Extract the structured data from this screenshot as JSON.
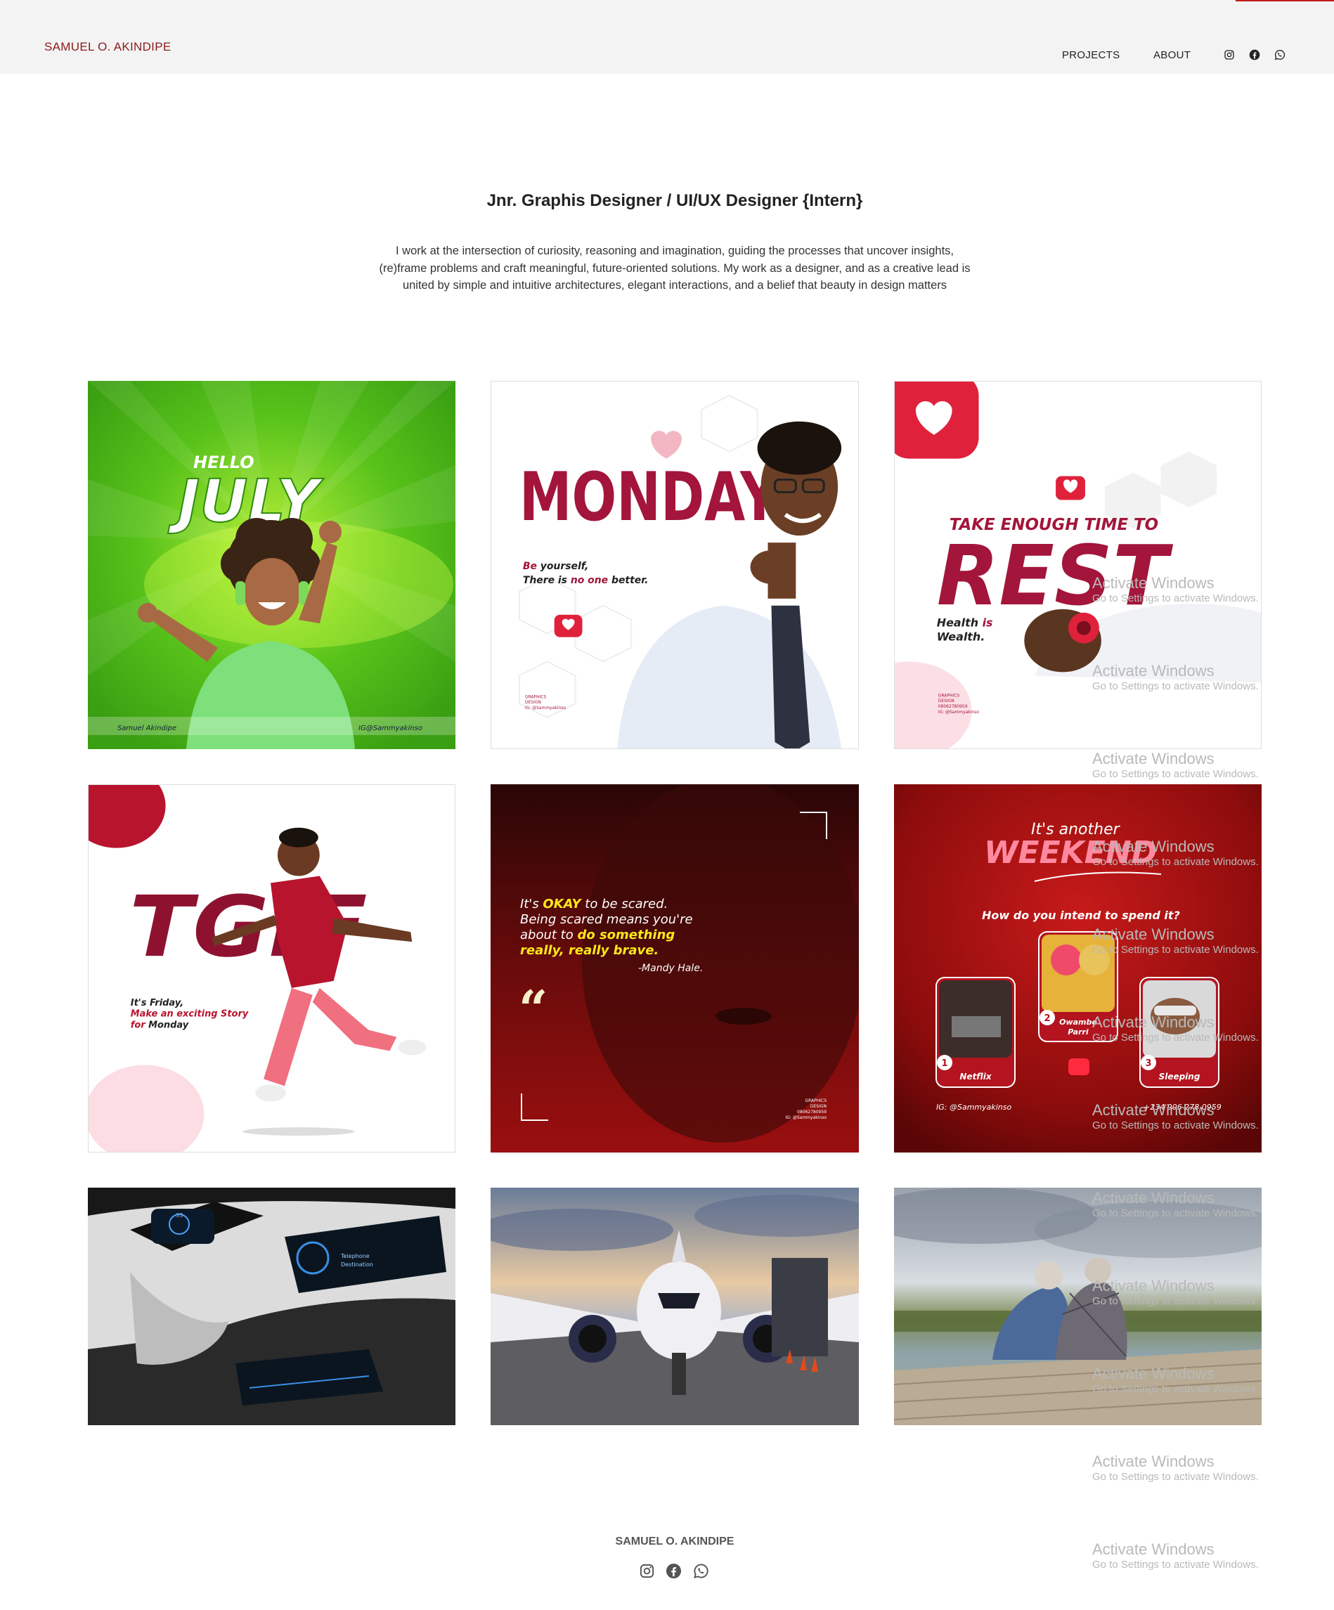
{
  "header": {
    "brand": "SAMUEL O. AKINDIPE",
    "nav": {
      "projects": "PROJECTS",
      "about": "ABOUT"
    },
    "social_icons": [
      "instagram-icon",
      "facebook-icon",
      "whatsapp-icon"
    ],
    "accent_color": "#8b1a1a"
  },
  "hero": {
    "title": "Jnr. Graphis Designer / UI/UX Designer {Intern}",
    "description_lines": [
      "I work at the intersection of curiosity, reasoning and imagination, guiding the processes that uncover insights,",
      "(re)frame problems and craft meaningful, future-oriented solutions. My work as a designer, and as a creative lead is",
      "united by simple and intuitive architectures, elegant interactions, and a belief that beauty in design matters"
    ]
  },
  "projects": {
    "hello_july": {
      "line1": "HELLO",
      "line2": "JULY",
      "left": "Samuel Akindipe",
      "right": "IG@Sammyakinso"
    },
    "monday": {
      "title": "MONDAY",
      "line1a": "Be",
      "line1b": " yourself,",
      "line2a": "There is ",
      "line2b": "no one",
      "line2c": " better.",
      "small1": "GRAPHICS",
      "small2": "DESIGN",
      "small3": "IG: @Sammyakinso"
    },
    "rest": {
      "top": "TAKE ENOUGH TIME TO",
      "title": "REST",
      "h1": "Health ",
      "h2": "is",
      "w": "Wealth.",
      "small1": "GRAPHICS",
      "small2": "DESIGN",
      "small3": "08062780959",
      "small4": "IG: @Sammyakinso"
    },
    "tgif": {
      "title": "TGIF",
      "l1a": "It's ",
      "l1b": "Friday,",
      "l2": "Make an exciting Story",
      "l3a": "for ",
      "l3b": "Monday"
    },
    "quote": {
      "q1": "It's ",
      "q1b": "OKAY",
      "q1c": " to be scared.",
      "q2": "Being scared means you're",
      "q3a": "about to ",
      "q3b": "do something",
      "q4": "really, really brave.",
      "author": "-Mandy Hale.",
      "s1": "GRAPHICS",
      "s2": "DESIGN",
      "s3": "08062780959",
      "s4": "IG: @Sammyakinso"
    },
    "weekend": {
      "small": "It's another",
      "title": "WEEKEND",
      "question": "How do you intend to spend it?",
      "o1": "Netflix",
      "o2a": "Owambe",
      "o2b": "Parri",
      "o3": "Sleeping",
      "n1": "1",
      "n2": "2",
      "n3": "3",
      "ig": "IG: @Sammyakinso",
      "phone": "+234 906 278 0959"
    },
    "car": {
      "dash": "33",
      "screen1": "Telephone",
      "screen2": "Destination"
    }
  },
  "watermark": {
    "title": "Activate Windows",
    "subtitle": "Go to Settings to activate Windows."
  },
  "footer": {
    "name": "SAMUEL O. AKINDIPE",
    "social_icons": [
      "instagram-icon",
      "facebook-icon",
      "whatsapp-icon"
    ]
  }
}
